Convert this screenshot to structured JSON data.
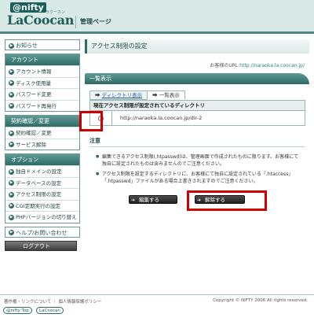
{
  "header": {
    "brand_nifty": "@nifty",
    "brand_lacoocan": "LaCoocan",
    "brand_ruby": "ラクーカン",
    "title": "管理ページ"
  },
  "sidebar": {
    "notice": "お知らせ",
    "account": {
      "heading": "アカウント",
      "items": [
        "アカウント情報",
        "ディスク使用量",
        "パスワード変更",
        "パスワード再発行"
      ]
    },
    "contract": {
      "heading": "契約確認／変更",
      "items": [
        "契約確認／変更",
        "サービス解除"
      ]
    },
    "options": {
      "heading": "オプション",
      "items": [
        "独自ドメインの設定",
        "データベースの設定",
        "アクセス制限の設定",
        "CGI定期実行の設定",
        "PHPバージョンの切り替え"
      ]
    },
    "help": "ヘルプ/お問い合わせ",
    "logout": "ログアウト"
  },
  "main": {
    "page_title": "アクセス制限の設定",
    "customer_url_label": "お客様のURL:",
    "customer_url": "http://naraoka.la.coocan.jp/",
    "section_title": "一覧表示",
    "tabs": [
      {
        "label": "ディレクトリ表示",
        "icon": "arrow-icon"
      },
      {
        "label": "一覧表示"
      }
    ],
    "table_header": "現在アクセス制限が設定されているディレクトリ",
    "directory": "http://naraoka.la.coocan.jp/dir-2",
    "note_title": "注意",
    "notes": [
      "編集できるアクセス制限(.htpasswd)は、管理画面で作成されたものに限ります。お客様にて独自に設定されたものは含みませんのでご注意ください。",
      "アクセス制限を設定するディレクトリに、お客様にて独自に設定されている「.htaccess」「.htpasswd」ファイルがある場合上書きされますのでご注意ください。"
    ],
    "edit_button": "編集する",
    "remove_button": "解除する"
  },
  "footer": {
    "left": "著作権・リンクについて ｜ 個人情報保護ポリシー",
    "right": "Copyright © NIFTY 2006 All rights reserved.",
    "logo1": "@nifty Top",
    "logo2": "LaCoocan"
  },
  "colors": {
    "accent": "#2f6a66",
    "highlight": "#cc0000"
  }
}
